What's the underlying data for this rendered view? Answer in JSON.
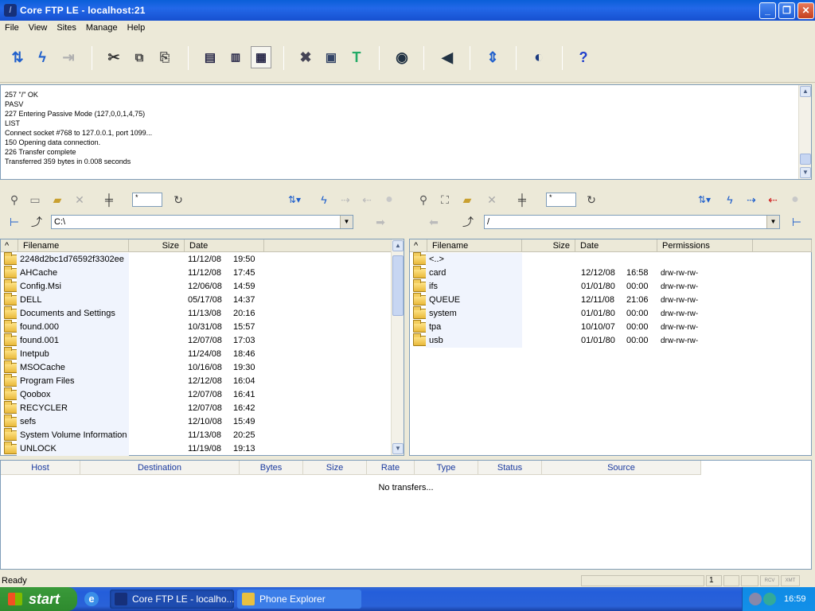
{
  "window": {
    "title": "Core FTP LE - localhost:21"
  },
  "menu": [
    "File",
    "View",
    "Sites",
    "Manage",
    "Help"
  ],
  "log": [
    "257 \"/\" OK",
    "PASV",
    "227 Entering Passive Mode (127,0,0,1,4,75)",
    "LIST",
    "Connect socket #768 to 127.0.0.1, port 1099...",
    "150 Opening data connection.",
    "226 Transfer complete",
    "Transferred 359 bytes in 0.008 seconds"
  ],
  "local": {
    "filter": "*",
    "path": "C:\\",
    "headers": {
      "filename": "Filename",
      "size": "Size",
      "date": "Date"
    },
    "files": [
      {
        "name": "2248d2bc1d76592f3302ee",
        "date": "11/12/08",
        "time": "19:50"
      },
      {
        "name": "AHCache",
        "date": "11/12/08",
        "time": "17:45"
      },
      {
        "name": "Config.Msi",
        "date": "12/06/08",
        "time": "14:59"
      },
      {
        "name": "DELL",
        "date": "05/17/08",
        "time": "14:37"
      },
      {
        "name": "Documents and Settings",
        "date": "11/13/08",
        "time": "20:16"
      },
      {
        "name": "found.000",
        "date": "10/31/08",
        "time": "15:57"
      },
      {
        "name": "found.001",
        "date": "12/07/08",
        "time": "17:03"
      },
      {
        "name": "Inetpub",
        "date": "11/24/08",
        "time": "18:46"
      },
      {
        "name": "MSOCache",
        "date": "10/16/08",
        "time": "19:30"
      },
      {
        "name": "Program Files",
        "date": "12/12/08",
        "time": "16:04"
      },
      {
        "name": "Qoobox",
        "date": "12/07/08",
        "time": "16:41"
      },
      {
        "name": "RECYCLER",
        "date": "12/07/08",
        "time": "16:42"
      },
      {
        "name": "sefs",
        "date": "12/10/08",
        "time": "15:49"
      },
      {
        "name": "System Volume Information",
        "date": "11/13/08",
        "time": "20:25"
      },
      {
        "name": "UNLOCK",
        "date": "11/19/08",
        "time": "19:13"
      }
    ]
  },
  "remote": {
    "filter": "*",
    "path": "/",
    "headers": {
      "filename": "Filename",
      "size": "Size",
      "date": "Date",
      "permissions": "Permissions"
    },
    "files": [
      {
        "name": "<..>",
        "date": "",
        "time": "",
        "perm": ""
      },
      {
        "name": "card",
        "date": "12/12/08",
        "time": "16:58",
        "perm": "drw-rw-rw-"
      },
      {
        "name": "ifs",
        "date": "01/01/80",
        "time": "00:00",
        "perm": "drw-rw-rw-"
      },
      {
        "name": "QUEUE",
        "date": "12/11/08",
        "time": "21:06",
        "perm": "drw-rw-rw-"
      },
      {
        "name": "system",
        "date": "01/01/80",
        "time": "00:00",
        "perm": "drw-rw-rw-"
      },
      {
        "name": "tpa",
        "date": "10/10/07",
        "time": "00:00",
        "perm": "drw-rw-rw-"
      },
      {
        "name": "usb",
        "date": "01/01/80",
        "time": "00:00",
        "perm": "drw-rw-rw-"
      }
    ]
  },
  "queue": {
    "headers": [
      "Host",
      "Destination",
      "Bytes",
      "Size",
      "Rate",
      "Type",
      "Status",
      "Source"
    ],
    "empty": "No transfers..."
  },
  "status": {
    "text": "Ready",
    "count": "1",
    "rcv": "RCV",
    "xmt": "XMT"
  },
  "taskbar": {
    "start": "start",
    "tasks": [
      "Core FTP LE - localho...",
      "Phone Explorer"
    ],
    "clock": "16:59"
  },
  "colors": {
    "titlebar": "#0a5fd8",
    "header_text": "#1a3a9f",
    "taskbar": "#245edb",
    "start": "#2e8a2e"
  }
}
